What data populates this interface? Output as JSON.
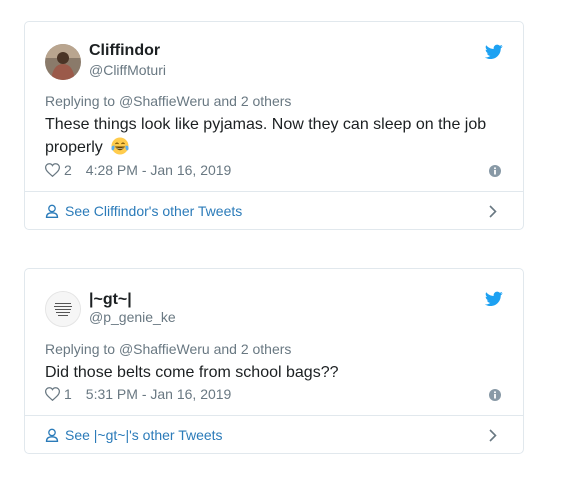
{
  "colors": {
    "twitter_blue": "#1da1f2",
    "link_blue": "#2b7bb9",
    "muted": "#697882",
    "border": "#e1e8ed"
  },
  "tweets": [
    {
      "name": "Cliffindor",
      "handle": "@CliffMoturi",
      "reply_prefix": "Replying to",
      "reply_to": "@ShaffieWeru and 2 others",
      "text": "These things look like pyjamas. Now they can sleep on the job properly",
      "emoji": "face-with-tears-of-joy",
      "likes": "2",
      "timestamp": "4:28 PM - Jan 16, 2019",
      "more_link": "See Cliffindor's other Tweets",
      "icons": {
        "brand": "twitter-bird-icon",
        "like": "heart-icon",
        "info": "info-icon",
        "profile": "person-icon",
        "nav": "chevron-right-icon"
      }
    },
    {
      "name": "|~gt~|",
      "handle": "@p_genie_ke",
      "reply_prefix": "Replying to",
      "reply_to": "@ShaffieWeru and 2 others",
      "text": "Did those belts come from school bags??",
      "likes": "1",
      "timestamp": "5:31 PM - Jan 16, 2019",
      "more_link": "See |~gt~|'s other Tweets",
      "icons": {
        "brand": "twitter-bird-icon",
        "like": "heart-icon",
        "info": "info-icon",
        "profile": "person-icon",
        "nav": "chevron-right-icon"
      }
    }
  ]
}
